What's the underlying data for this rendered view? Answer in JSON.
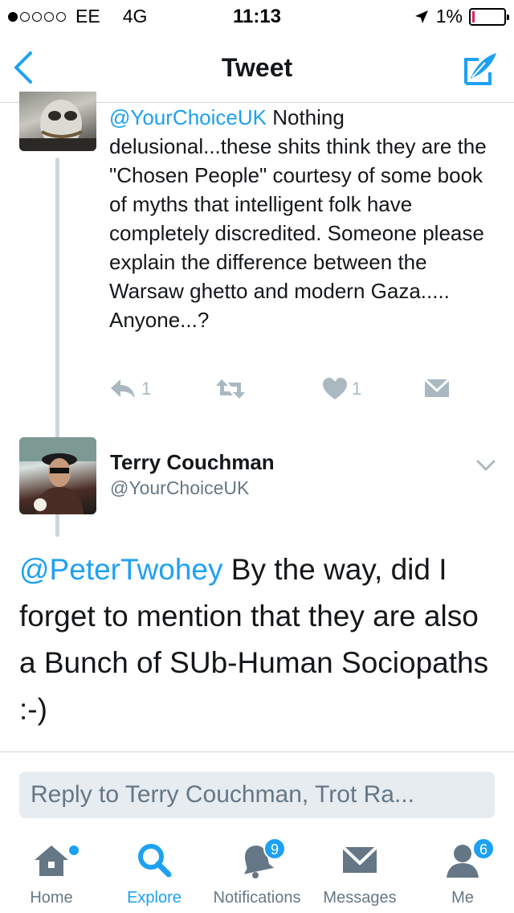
{
  "status_bar": {
    "carrier": "EE",
    "network": "4G",
    "time": "11:13",
    "battery": "1%"
  },
  "nav": {
    "title": "Tweet",
    "back_icon": "chevron-left-icon",
    "compose_icon": "compose-quill-icon"
  },
  "parent_tweet": {
    "mention": "@YourChoiceUK",
    "text": " Nothing delusional...these shits think they are the \"Chosen People\" courtesy of some book of myths that intelligent folk have completely discredited. Someone please explain the difference between the Warsaw ghetto and modern Gaza..... Anyone...?",
    "reply_count": "1",
    "like_count": "1"
  },
  "main_tweet": {
    "author_name": "Terry Couchman",
    "author_handle": "@YourChoiceUK",
    "mention": "@PeterTwohey",
    "text": " By the way, did I forget to mention that they are also a Bunch of SUb-Human Sociopaths :-)"
  },
  "reply": {
    "placeholder": "Reply to Terry Couchman, Trot Ra..."
  },
  "tabs": [
    {
      "label": "Home",
      "icon": "home-icon"
    },
    {
      "label": "Explore",
      "icon": "search-icon"
    },
    {
      "label": "Notifications",
      "icon": "bell-icon",
      "badge": "9"
    },
    {
      "label": "Messages",
      "icon": "envelope-icon"
    },
    {
      "label": "Me",
      "icon": "profile-icon",
      "badge": "6"
    }
  ],
  "colors": {
    "accent": "#1da1f2",
    "muted": "#657786",
    "action": "#aab8c2",
    "battery_low": "#e0245e"
  }
}
